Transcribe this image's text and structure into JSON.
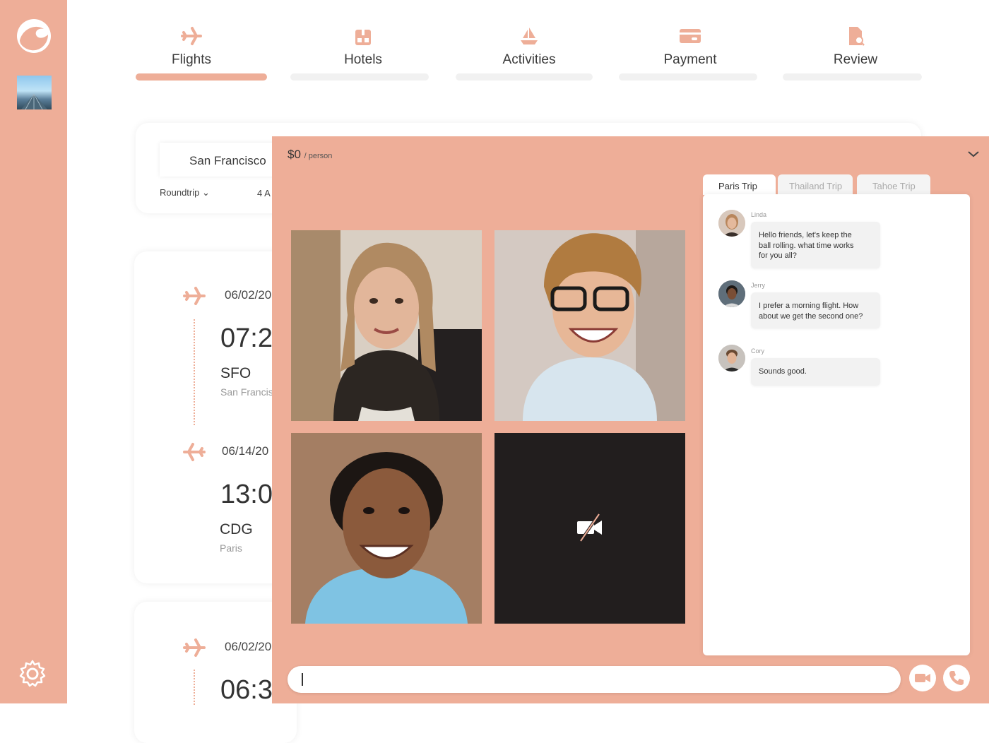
{
  "tabs": [
    {
      "label": "Flights",
      "icon": "airplane-icon",
      "active": true
    },
    {
      "label": "Hotels",
      "icon": "hotel-icon",
      "active": false
    },
    {
      "label": "Activities",
      "icon": "boat-icon",
      "active": false
    },
    {
      "label": "Payment",
      "icon": "credit-card-icon",
      "active": false
    },
    {
      "label": "Review",
      "icon": "document-search-icon",
      "active": false
    }
  ],
  "search": {
    "origin": "San Francisco",
    "trip_type": "Roundtrip ⌄",
    "passengers": "4 A"
  },
  "flights": [
    {
      "outbound": {
        "date": "06/02/20",
        "time": "07:2",
        "code": "SFO",
        "city": "San Francis"
      },
      "inbound": {
        "date": "06/14/20",
        "time": "13:0",
        "code": "CDG",
        "city": "Paris"
      }
    },
    {
      "outbound": {
        "date": "06/02/20",
        "time": "06:3"
      }
    }
  ],
  "call_panel": {
    "price": "$0",
    "per_label": "/ person",
    "chat_tabs": [
      "Paris Trip",
      "Thailand Trip",
      "Tahoe Trip"
    ],
    "messages": [
      {
        "name": "Linda",
        "lines": [
          "Hello friends, let's keep the",
          "ball rolling. what time works",
          "for you all?"
        ]
      },
      {
        "name": "Jerry",
        "lines": [
          "I prefer a morning flight. How",
          "about we get the second one?"
        ]
      },
      {
        "name": "Cory",
        "lines": [
          "Sounds good."
        ]
      }
    ],
    "input_cursor": "|"
  },
  "colors": {
    "accent": "#eeae98",
    "dark_tile": "#221e1e"
  }
}
